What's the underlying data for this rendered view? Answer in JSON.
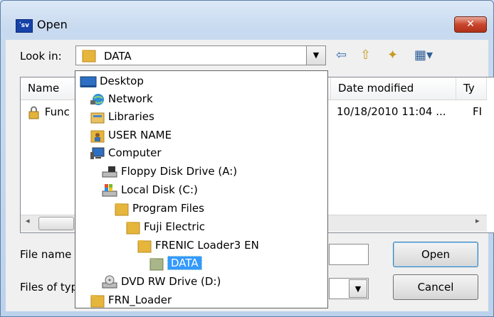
{
  "window": {
    "title": "Open",
    "app_icon_text": "ʹsv",
    "close_glyph": "✕"
  },
  "look_in": {
    "label": "Look in:",
    "value": "DATA",
    "drop_arrow": "▼"
  },
  "toolbar": {
    "back_glyph": "⇦",
    "up_glyph": "⇧",
    "new_folder_glyph": "✦",
    "views_glyph": "▦▾"
  },
  "columns": [
    {
      "label": "Name"
    },
    {
      "label": "Date modified"
    },
    {
      "label": "Ty"
    }
  ],
  "files": [
    {
      "name": "Func",
      "date": "10/18/2010 11:04 ...",
      "type": "FI"
    }
  ],
  "scroll": {
    "left_arrow": "◂",
    "right_arrow": "▸"
  },
  "file_name": {
    "label": "File name",
    "value": ""
  },
  "file_type": {
    "label": "Files of typ",
    "drop_arrow": "▼"
  },
  "buttons": {
    "open": "Open",
    "cancel": "Cancel"
  },
  "dropdown_items": [
    {
      "label": "Desktop",
      "icon": "desktop-icon"
    },
    {
      "label": "Network",
      "icon": "network-icon"
    },
    {
      "label": "Libraries",
      "icon": "libraries-icon"
    },
    {
      "label": "USER NAME",
      "icon": "user-folder-icon"
    },
    {
      "label": "Computer",
      "icon": "computer-icon"
    },
    {
      "label": "Floppy Disk Drive (A:)",
      "icon": "floppy-drive-icon"
    },
    {
      "label": "Local Disk (C:)",
      "icon": "local-disk-icon"
    },
    {
      "label": "Program Files",
      "icon": "folder-icon"
    },
    {
      "label": "Fuji Electric",
      "icon": "folder-icon"
    },
    {
      "label": "FRENIC Loader3 EN",
      "icon": "folder-icon"
    },
    {
      "label": "DATA",
      "icon": "folder-open-icon",
      "selected": true
    },
    {
      "label": "DVD RW Drive (D:)",
      "icon": "dvd-drive-icon"
    },
    {
      "label": "FRN_Loader",
      "icon": "folder-icon"
    }
  ]
}
